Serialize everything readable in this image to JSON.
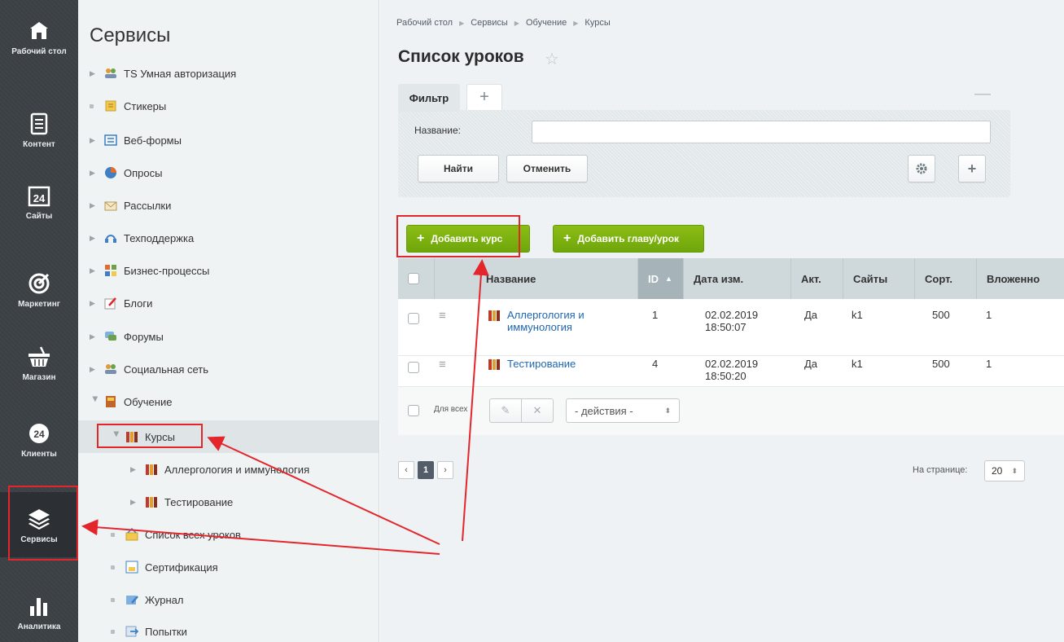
{
  "rail": [
    {
      "label": "Рабочий стол",
      "icon": "home-icon"
    },
    {
      "label": "Контент",
      "icon": "document-icon"
    },
    {
      "label": "Сайты",
      "icon": "calendar-24-icon",
      "badge": "24"
    },
    {
      "label": "Маркетинг",
      "icon": "target-icon"
    },
    {
      "label": "Магазин",
      "icon": "basket-icon"
    },
    {
      "label": "Клиенты",
      "icon": "clients-24-icon",
      "badge": "24"
    },
    {
      "label": "Сервисы",
      "icon": "layers-icon",
      "active": true
    },
    {
      "label": "Аналитика",
      "icon": "bar-chart-icon"
    }
  ],
  "tree": {
    "title": "Сервисы",
    "items": [
      {
        "label": "TS Умная авторизация",
        "icon": "users-icon"
      },
      {
        "label": "Стикеры",
        "icon": "sticker-icon"
      },
      {
        "label": "Веб-формы",
        "icon": "form-icon"
      },
      {
        "label": "Опросы",
        "icon": "pie-icon"
      },
      {
        "label": "Рассылки",
        "icon": "mail-icon"
      },
      {
        "label": "Техподдержка",
        "icon": "headset-icon"
      },
      {
        "label": "Бизнес-процессы",
        "icon": "process-icon"
      },
      {
        "label": "Блоги",
        "icon": "pencil-icon"
      },
      {
        "label": "Форумы",
        "icon": "chat-icon"
      },
      {
        "label": "Социальная сеть",
        "icon": "users-icon"
      },
      {
        "label": "Обучение",
        "icon": "book-icon"
      },
      {
        "label": "Курсы",
        "icon": "books-icon"
      },
      {
        "label": "Аллергология и иммунология",
        "icon": "books-icon"
      },
      {
        "label": "Тестирование",
        "icon": "books-icon"
      },
      {
        "label": "Список всех уроков",
        "icon": "lessons-icon"
      },
      {
        "label": "Сертификация",
        "icon": "certificate-icon"
      },
      {
        "label": "Журнал",
        "icon": "journal-icon"
      },
      {
        "label": "Попытки",
        "icon": "attempts-icon"
      }
    ]
  },
  "breadcrumb": [
    "Рабочий стол",
    "Сервисы",
    "Обучение",
    "Курсы"
  ],
  "page_title": "Список уроков",
  "filter": {
    "tab": "Фильтр",
    "field_label": "Название:",
    "field_value": "",
    "find": "Найти",
    "cancel": "Отменить"
  },
  "toolbar": {
    "add_course": "Добавить курс",
    "add_chapter": "Добавить главу/урок"
  },
  "grid": {
    "columns": [
      "Название",
      "ID",
      "Дата изм.",
      "Акт.",
      "Сайты",
      "Сорт.",
      "Вложенно"
    ],
    "rows": [
      {
        "name": "Аллергология и иммунология",
        "name_l1": "Аллергология и",
        "name_l2": "иммунология",
        "id": "1",
        "date": "02.02.2019",
        "time": "18:50:07",
        "active": "Да",
        "sites": "k1",
        "sort": "500",
        "nested": "1"
      },
      {
        "name": "Тестирование",
        "name_l1": "Тестирование",
        "name_l2": "",
        "id": "4",
        "date": "02.02.2019",
        "time": "18:50:20",
        "active": "Да",
        "sites": "k1",
        "sort": "500",
        "nested": "1"
      }
    ],
    "for_all": "Для всех",
    "actions": "- действия -"
  },
  "pager": {
    "current": "1",
    "per_page_label": "На странице:",
    "per_page_value": "20"
  },
  "colors": {
    "accent_green": "#7cb30f",
    "annotation_red": "#e3262c",
    "link": "#2067b0"
  }
}
